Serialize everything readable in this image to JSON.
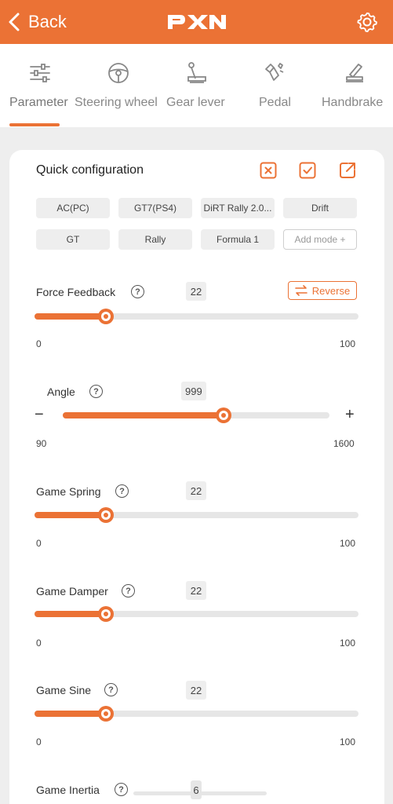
{
  "header": {
    "back_label": "Back",
    "logo_text": "PXN"
  },
  "tabs": [
    {
      "label": "Parameter",
      "icon": "sliders-icon",
      "active": true
    },
    {
      "label": "Steering wheel",
      "icon": "steering-wheel-icon",
      "active": false
    },
    {
      "label": "Gear lever",
      "icon": "gear-lever-icon",
      "active": false
    },
    {
      "label": "Pedal",
      "icon": "pedal-icon",
      "active": false
    },
    {
      "label": "Handbrake",
      "icon": "handbrake-icon",
      "active": false
    }
  ],
  "quick_config": {
    "title": "Quick configuration",
    "actions": [
      "delete-icon",
      "confirm-icon",
      "export-icon"
    ],
    "modes": [
      "AC(PC)",
      "GT7(PS4)",
      "DiRT Rally 2.0...",
      "Drift",
      "GT",
      "Rally",
      "Formula 1"
    ],
    "add_mode": "Add mode +"
  },
  "params": {
    "force_feedback": {
      "label": "Force Feedback",
      "help": "?",
      "value": "22",
      "min": "0",
      "max": "100",
      "reverse_label": "Reverse"
    },
    "angle": {
      "label": "Angle",
      "help": "?",
      "value": "999",
      "min": "90",
      "max": "1600",
      "minus": "−",
      "plus": "+"
    },
    "game_spring": {
      "label": "Game Spring",
      "help": "?",
      "value": "22",
      "min": "0",
      "max": "100"
    },
    "game_damper": {
      "label": "Game Damper",
      "help": "?",
      "value": "22",
      "min": "0",
      "max": "100"
    },
    "game_sine": {
      "label": "Game Sine",
      "help": "?",
      "value": "22",
      "min": "0",
      "max": "100"
    },
    "game_inertia": {
      "label": "Game Inertia",
      "help": "?",
      "value": "6"
    }
  },
  "colors": {
    "accent": "#eb7235",
    "track": "#e6e6e6",
    "chip": "#eeeeee"
  }
}
